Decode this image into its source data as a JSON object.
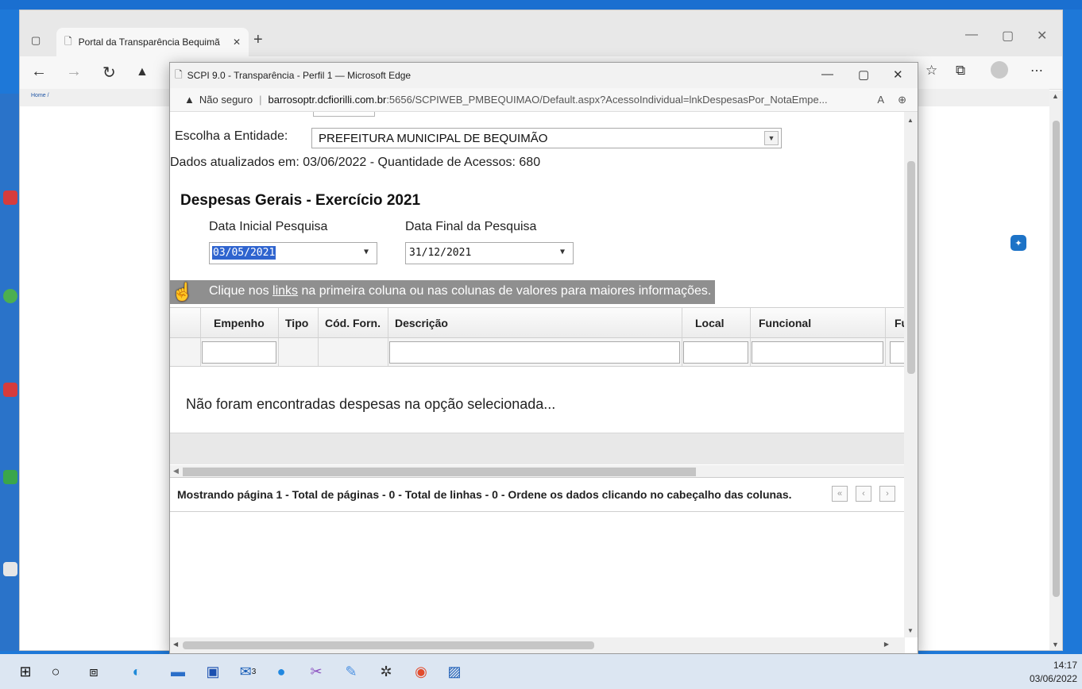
{
  "outer_browser": {
    "tab_title": "Portal da Transparência Bequimã",
    "home_breadcrumb": "Home /"
  },
  "popup": {
    "title": "SCPI 9.0 - Transparência - Perfil 1 — Microsoft Edge",
    "security_label": "Não seguro",
    "url_host": "barrosoptr.dcfiorilli.com.br",
    "url_path": ":5656/SCPIWEB_PMBEQUIMAO/Default.aspx?AcessoIndividual=lnkDespesasPor_NotaEmpe..."
  },
  "page": {
    "entity_label": "Escolha a Entidade:",
    "entity_value": "PREFEITURA MUNICIPAL DE BEQUIMÃO",
    "updated_text": "Dados atualizados em: 03/06/2022 - Quantidade de Acessos: 680",
    "section_title": "Despesas Gerais - Exercício 2021",
    "start_date_label": "Data Inicial Pesquisa",
    "start_date_value": "03/05/2021",
    "end_date_label": "Data Final da Pesquisa",
    "end_date_value": "31/12/2021",
    "info_prefix": "Clique nos ",
    "info_link": "links",
    "info_suffix": " na primeira coluna ou nas colunas de valores para maiores informações.",
    "columns": [
      "Empenho",
      "Tipo",
      "Cód. Forn.",
      "Descrição",
      "Local",
      "Funcional",
      "Fu"
    ],
    "empty_message": "Não foram encontradas despesas na opção selecionada...",
    "pager_text": "Mostrando página 1 - Total de páginas - 0 - Total de linhas - 0 - Ordene os dados clicando no cabeçalho das colunas."
  },
  "taskbar": {
    "time": "14:17",
    "date": "03/06/2022",
    "badge_count": "3"
  },
  "colors": {
    "info_bar": "#8f8f8f",
    "selection": "#2f64cf",
    "desktop": "#1e78d8"
  }
}
